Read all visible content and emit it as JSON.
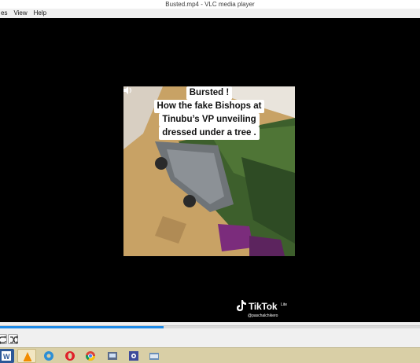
{
  "window": {
    "title": "Busted.mp4 - VLC media player"
  },
  "menu": {
    "items": [
      {
        "label": "es"
      },
      {
        "label": "View"
      },
      {
        "label": "Help"
      }
    ]
  },
  "video": {
    "caption_lines": [
      "Bursted !",
      "How the fake Bishops at",
      "Tinubu’s VP unveiling",
      "dressed under a tree ."
    ],
    "watermark": {
      "brand": "TikTok",
      "variant": "Lite",
      "handle": "@paschalchikero"
    }
  },
  "playback": {
    "progress": 0.39
  },
  "icons": {
    "volume": "volume-icon",
    "loop": "loop-icon",
    "shuffle": "shuffle-icon"
  },
  "taskbar": {
    "apps": [
      "word-icon",
      "vlc-icon",
      "edge-icon",
      "opera-icon",
      "chrome-icon",
      "app-icon",
      "settings-icon",
      "explorer-icon"
    ]
  },
  "colors": {
    "accent": "#1e8ae6",
    "taskbar": "#d9cfa6"
  }
}
